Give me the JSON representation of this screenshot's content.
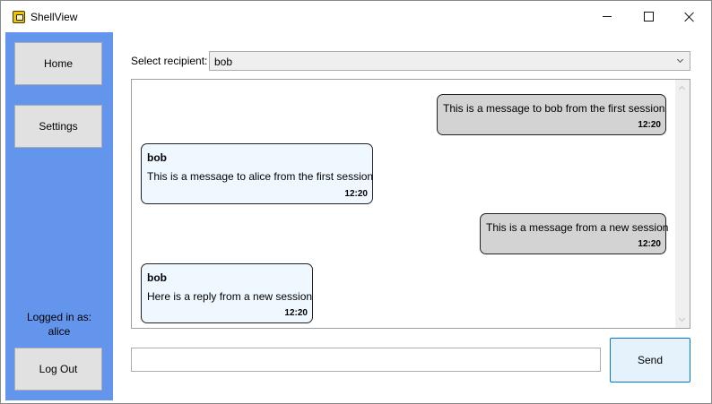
{
  "window": {
    "title": "ShellView",
    "icon": "app-icon"
  },
  "titlebar_buttons": {
    "minimize_icon": "minimize-icon",
    "maximize_icon": "maximize-icon",
    "close_icon": "close-icon"
  },
  "sidebar": {
    "background": "#6495ed",
    "home_label": "Home",
    "settings_label": "Settings",
    "logged_in_label": "Logged in as:",
    "logged_in_user": "alice",
    "logout_label": "Log Out"
  },
  "recipient": {
    "label": "Select recipient:",
    "selected": "bob"
  },
  "messages": [
    {
      "direction": "outgoing",
      "sender": "",
      "text": "This is a message to bob from the first session",
      "time": "12:20"
    },
    {
      "direction": "incoming",
      "sender": "bob",
      "text": "This is a message to alice from the first session",
      "time": "12:20"
    },
    {
      "direction": "outgoing",
      "sender": "",
      "text": "This is a message from a new session",
      "time": "12:20"
    },
    {
      "direction": "incoming",
      "sender": "bob",
      "text": "Here is a reply from a new session",
      "time": "12:20"
    }
  ],
  "colors": {
    "outgoing_bubble": "#d3d3d3",
    "incoming_bubble": "#f0f8ff",
    "send_button_border": "#0078d7"
  },
  "composer": {
    "value": "",
    "placeholder": "",
    "send_label": "Send"
  }
}
